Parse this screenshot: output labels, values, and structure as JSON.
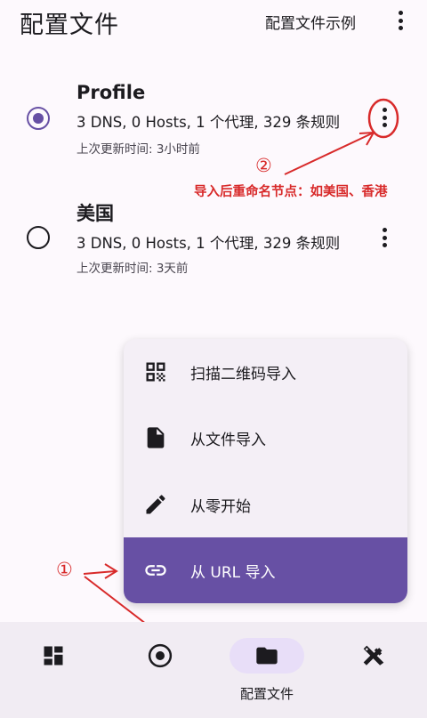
{
  "header": {
    "title": "配置文件",
    "example_label": "配置文件示例"
  },
  "profiles": [
    {
      "name": "Profile",
      "stats": "3 DNS, 0 Hosts, 1 个代理, 329 条规则",
      "updated": "上次更新时间: 3小时前",
      "selected": true
    },
    {
      "name": "美国",
      "stats": "3 DNS, 0 Hosts, 1 个代理, 329 条规则",
      "updated": "上次更新时间: 3天前",
      "selected": false
    }
  ],
  "menu": {
    "items": [
      {
        "label": "扫描二维码导入",
        "icon": "qr-code-icon"
      },
      {
        "label": "从文件导入",
        "icon": "file-icon"
      },
      {
        "label": "从零开始",
        "icon": "pencil-icon"
      },
      {
        "label": "从 URL 导入",
        "icon": "link-icon"
      }
    ]
  },
  "bottom_nav": {
    "active_label": "配置文件",
    "items": [
      "dashboard-icon",
      "proxy-icon",
      "folder-icon",
      "tools-icon"
    ]
  },
  "annotations": {
    "step1": "①",
    "step2": "②",
    "note": "导入后重命名节点：如美国、香港"
  },
  "colors": {
    "accent": "#6750a4",
    "annotation": "#d82a2a",
    "active_nav": "#e8def8"
  }
}
